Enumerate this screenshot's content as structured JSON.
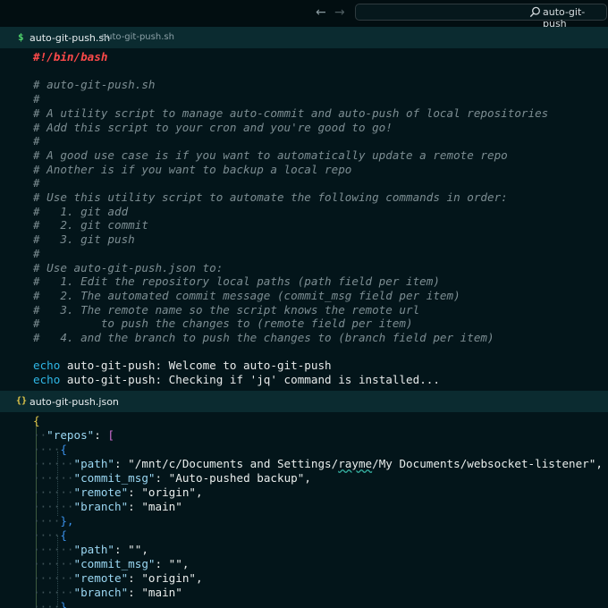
{
  "titlebar": {
    "back_glyph": "←",
    "forward_glyph": "→",
    "search_text": "auto-git-push",
    "search_icon": "search-icon"
  },
  "editor_sh": {
    "tab_icon": "$",
    "tab_name": "auto-git-push.sh",
    "tab_path": "auto-git-push.sh",
    "lines": [
      "#!/bin/bash",
      "",
      "# auto-git-push.sh",
      "#",
      "# A utility script to manage auto-commit and auto-push of local repositories",
      "# Add this script to your cron and you're good to go!",
      "#",
      "# A good use case is if you want to automatically update a remote repo",
      "# Another is if you want to backup a local repo",
      "#",
      "# Use this utility script to automate the following commands in order:",
      "#   1. git add",
      "#   2. git commit",
      "#   3. git push",
      "#",
      "# Use auto-git-push.json to:",
      "#   1. Edit the repository local paths (path field per item)",
      "#   2. The automated commit message (commit_msg field per item)",
      "#   3. The remote name so the script knows the remote url",
      "#         to push the changes to (remote field per item)",
      "#   4. and the branch to push the changes to (branch field per item)",
      "",
      "echo|auto-git-push: Welcome to auto-git-push",
      "echo|auto-git-push: Checking if 'jq' command is installed..."
    ]
  },
  "editor_json": {
    "tab_icon": "{}",
    "tab_name": "auto-git-push.json",
    "tokens": {
      "open_brace": "{",
      "repos_key": "\"repos\"",
      "colon": ": ",
      "open_bracket": "[",
      "item_open": "{",
      "item_close_comma": "},",
      "item_close": "}",
      "comma": ","
    },
    "items": [
      {
        "path_key": "\"path\"",
        "path_pre": "\"/mnt/c/Documents and Settings/",
        "path_squiggle": "rayme",
        "path_post": "/My Documents/websocket-listener\"",
        "commit_msg_key": "\"commit_msg\"",
        "commit_msg": "\"Auto-pushed backup\"",
        "remote_key": "\"remote\"",
        "remote": "\"origin\"",
        "branch_key": "\"branch\"",
        "branch": "\"main\""
      },
      {
        "path_key": "\"path\"",
        "path": "\"\"",
        "commit_msg_key": "\"commit_msg\"",
        "commit_msg": "\"\"",
        "remote_key": "\"remote\"",
        "remote": "\"origin\"",
        "branch_key": "\"branch\"",
        "branch": "\"main\""
      }
    ]
  }
}
